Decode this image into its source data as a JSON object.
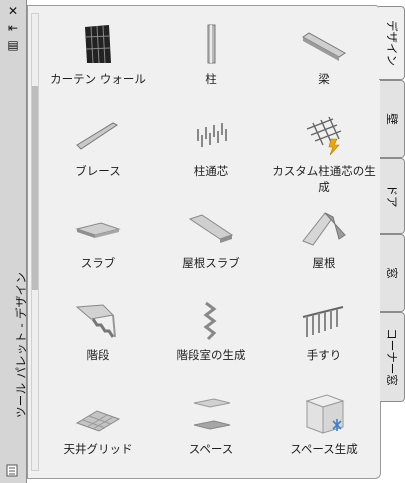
{
  "palette": {
    "title": "ツール パレット - デザイン",
    "controls": {
      "close": "✕",
      "autohide": "⇤",
      "properties": "▤"
    }
  },
  "tools": [
    {
      "label": "カーテン ウォール",
      "icon": "curtain-wall-icon"
    },
    {
      "label": "柱",
      "icon": "column-icon"
    },
    {
      "label": "梁",
      "icon": "beam-icon"
    },
    {
      "label": "ブレース",
      "icon": "brace-icon"
    },
    {
      "label": "柱通芯",
      "icon": "column-grid-icon"
    },
    {
      "label": "カスタム柱通芯の生成",
      "icon": "custom-column-grid-icon"
    },
    {
      "label": "スラブ",
      "icon": "slab-icon"
    },
    {
      "label": "屋根スラブ",
      "icon": "roof-slab-icon"
    },
    {
      "label": "屋根",
      "icon": "roof-icon"
    },
    {
      "label": "階段",
      "icon": "stair-icon"
    },
    {
      "label": "階段室の生成",
      "icon": "stair-tower-icon"
    },
    {
      "label": "手すり",
      "icon": "railing-icon"
    },
    {
      "label": "天井グリッド",
      "icon": "ceiling-grid-icon"
    },
    {
      "label": "スペース",
      "icon": "space-icon"
    },
    {
      "label": "スペース生成",
      "icon": "space-generate-icon"
    }
  ],
  "tabs": [
    {
      "label": "デザイン",
      "active": true
    },
    {
      "label": "壁",
      "active": false
    },
    {
      "label": "ドア",
      "active": false
    },
    {
      "label": "窓",
      "active": false
    },
    {
      "label": "コーナー窓",
      "active": false
    }
  ]
}
